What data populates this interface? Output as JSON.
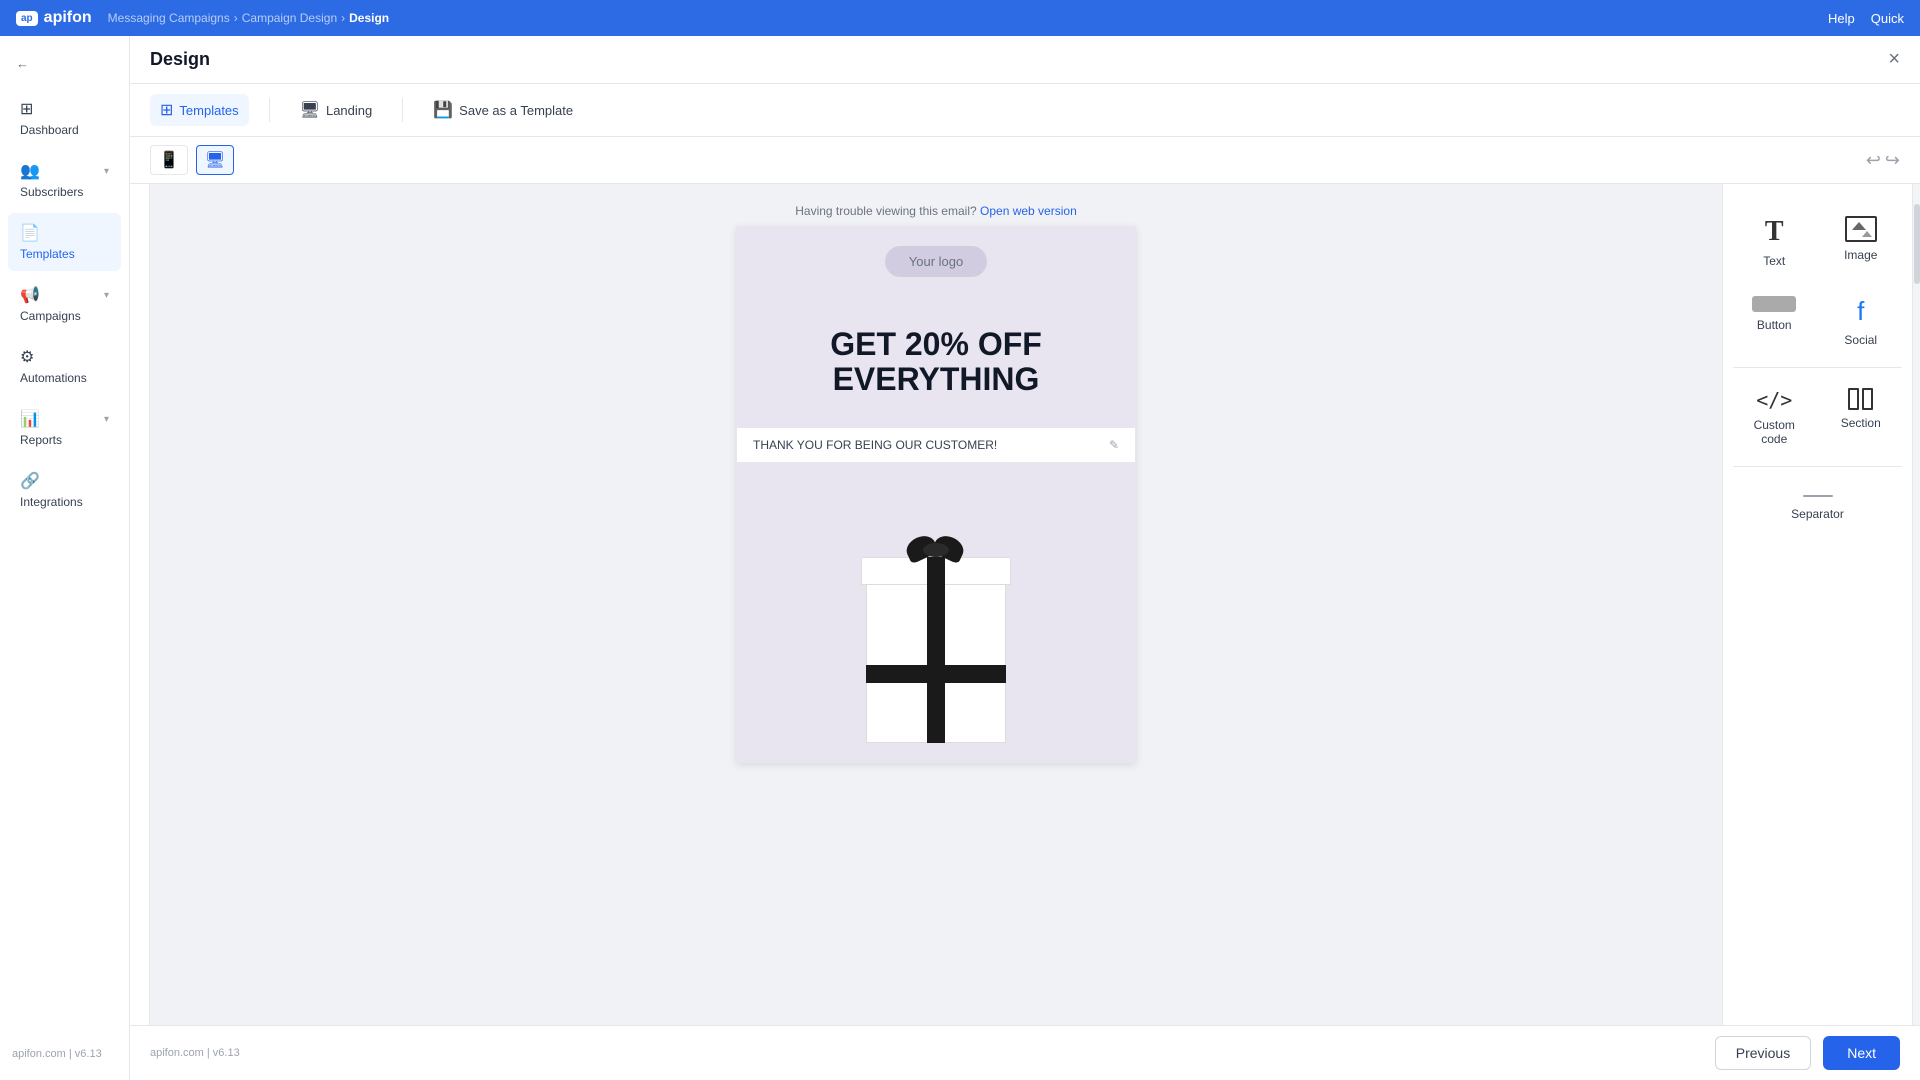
{
  "topbar": {
    "logo_text": "apifon",
    "breadcrumb": {
      "part1": "Messaging Campaigns",
      "sep1": "›",
      "part2": "Campaign Design",
      "sep2": "›",
      "current": "Design"
    },
    "help_label": "Help",
    "quick_label": "Quick"
  },
  "sidebar": {
    "back_label": "←",
    "items": [
      {
        "id": "dashboard",
        "label": "Dashboard",
        "icon": "⊞"
      },
      {
        "id": "subscribers",
        "label": "Subscribers",
        "icon": "👥",
        "has_chevron": true
      },
      {
        "id": "templates",
        "label": "Templates",
        "icon": "📄",
        "active": true
      },
      {
        "id": "campaigns",
        "label": "Campaigns",
        "icon": "📢",
        "has_chevron": true
      },
      {
        "id": "automations",
        "label": "Automations",
        "icon": "⚙"
      },
      {
        "id": "reports",
        "label": "Reports",
        "icon": "📊",
        "has_chevron": true
      },
      {
        "id": "integrations",
        "label": "Integrations",
        "icon": "🔗"
      }
    ],
    "version": "apifon.com | v6.13"
  },
  "design": {
    "title": "Design",
    "tabs": [
      {
        "id": "templates",
        "label": "Templates",
        "active": true,
        "icon": "⊞"
      },
      {
        "id": "landing",
        "label": "Landing",
        "icon": "🖥"
      },
      {
        "id": "save_template",
        "label": "Save as a Template",
        "icon": "💾"
      }
    ],
    "close_icon": "×"
  },
  "toolbar": {
    "mobile_icon": "📱",
    "desktop_icon": "🖥",
    "undo_label": "↩",
    "redo_label": "↪"
  },
  "email": {
    "notice_text": "Having trouble viewing this email?",
    "notice_link": "Open web version",
    "logo_placeholder": "Your logo",
    "hero_line1": "GET 20% OFF",
    "hero_line2": "EVERYTHING",
    "thank_you_text": "THANK YOU FOR BEING OUR CUSTOMER!"
  },
  "right_panel": {
    "items": [
      {
        "id": "text",
        "label": "Text",
        "icon": "T"
      },
      {
        "id": "image",
        "label": "Image",
        "icon": "image"
      },
      {
        "id": "button",
        "label": "Button",
        "icon": "button"
      },
      {
        "id": "social",
        "label": "Social",
        "icon": "social"
      },
      {
        "id": "custom_code",
        "label": "Custom code",
        "icon": "code"
      },
      {
        "id": "section",
        "label": "Section",
        "icon": "section"
      },
      {
        "id": "separator",
        "label": "Separator",
        "icon": "separator"
      }
    ]
  },
  "bottom": {
    "version": "apifon.com | v6.13",
    "previous_label": "Previous",
    "next_label": "Next"
  }
}
